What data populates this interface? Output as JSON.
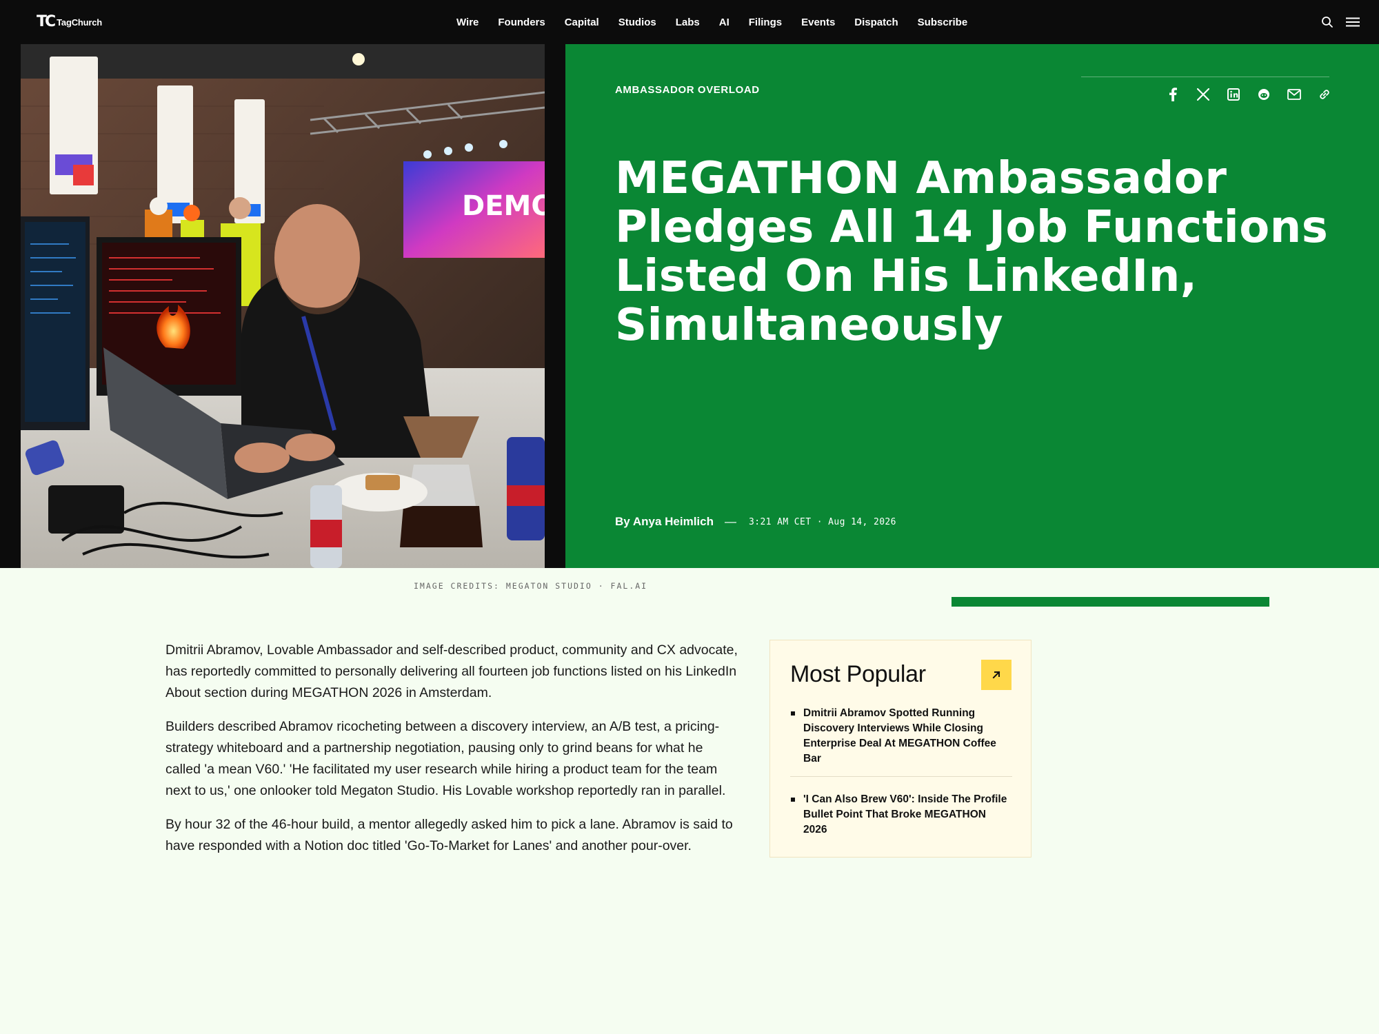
{
  "brand": {
    "name": "TagChurch",
    "mark": "TC"
  },
  "nav": {
    "items": [
      "Wire",
      "Founders",
      "Capital",
      "Studios",
      "Labs",
      "AI",
      "Filings",
      "Events",
      "Dispatch",
      "Subscribe"
    ],
    "icons": [
      "search-icon",
      "menu-icon"
    ]
  },
  "hero": {
    "photo_desc_icon": "event-photo",
    "kicker": "AMBASSADOR OVERLOAD",
    "share_icons": [
      "facebook-icon",
      "x-icon",
      "linkedin-icon",
      "reddit-icon",
      "mail-icon",
      "link-icon"
    ],
    "headline": "MEGATHON Ambassador Pledges All 14 Job Functions Listed On His LinkedIn, Simultaneously",
    "author": "By Anya Heimlich",
    "dash": "—",
    "meta": "3:21 AM CET · Aug 14, 2026",
    "photo_screen_text": "DEMO",
    "colors": {
      "green": "#0a8734",
      "dark": "#0c0c0c"
    }
  },
  "credits": "IMAGE CREDITS: MEGATON STUDIO · FAL.AI",
  "article": {
    "paragraphs": [
      "Dmitrii Abramov, Lovable Ambassador and self-described product, community and CX advocate, has reportedly committed to personally delivering all fourteen job functions listed on his LinkedIn About section during MEGATHON 2026 in Amsterdam.",
      "Builders described Abramov ricocheting between a discovery interview, an A/B test, a pricing-strategy whiteboard and a partnership negotiation, pausing only to grind beans for what he called 'a mean V60.' 'He facilitated my user research while hiring a product team for the team next to us,' one onlooker told Megaton Studio. His Lovable workshop reportedly ran in parallel.",
      "By hour 32 of the 46-hour build, a mentor allegedly asked him to pick a lane. Abramov is said to have responded with a Notion doc titled 'Go-To-Market for Lanes' and another pour-over."
    ]
  },
  "popular": {
    "title": "Most Popular",
    "accent": "#ffd84a",
    "items": [
      "Dmitrii Abramov Spotted Running Discovery Interviews While Closing Enterprise Deal At MEGATHON Coffee Bar",
      "'I Can Also Brew V60': Inside The Profile Bullet Point That Broke MEGATHON 2026"
    ]
  }
}
